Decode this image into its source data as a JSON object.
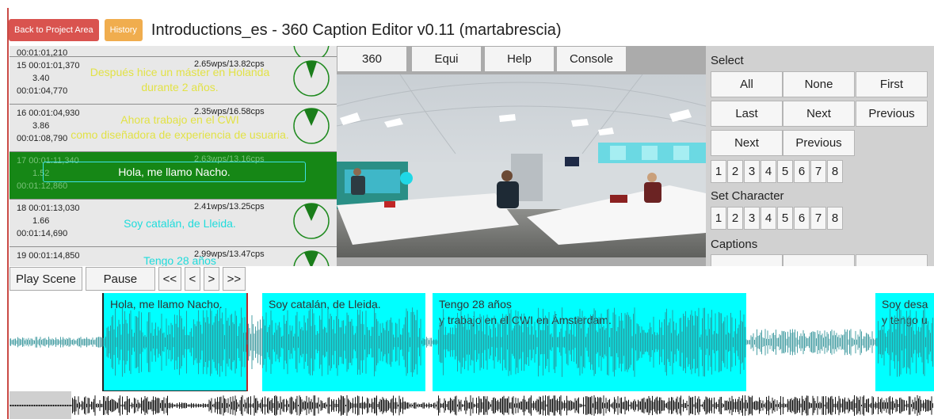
{
  "header": {
    "back_label": "Back to Project Area",
    "history_label": "History",
    "title": "Introductions_es - 360 Caption Editor v0.11 (martabrescia)"
  },
  "caption_list": {
    "partial_top": {
      "end": "00:01:01,210"
    },
    "rows": [
      {
        "index_start": "15 00:01:01,370",
        "duration": "3.40",
        "end": "00:01:04,770",
        "rate": "2.65wps/13.82cps",
        "lines": [
          "Después hice un máster en Holanda",
          "durante 2 años."
        ],
        "color": "yellow",
        "active": false,
        "gauge_fraction": 0.08
      },
      {
        "index_start": "16 00:01:04,930",
        "duration": "3.86",
        "end": "00:01:08,790",
        "rate": "2.35wps/16.58cps",
        "lines": [
          "Ahora trabajo en el CWI",
          "como diseñadora de experiencia de usuaria."
        ],
        "color": "yellow",
        "active": false,
        "gauge_fraction": 0.1
      },
      {
        "index_start": "17 00:01:11,340",
        "duration": "1.52",
        "end": "00:01:12,860",
        "rate": "2.63wps/13.16cps",
        "lines": [
          "Hola, me llamo Nacho."
        ],
        "color": "white",
        "active": true,
        "gauge_fraction": 0.1
      },
      {
        "index_start": "18 00:01:13,030",
        "duration": "1.66",
        "end": "00:01:14,690",
        "rate": "2.41wps/13.25cps",
        "lines": [
          "Soy catalán, de Lleida."
        ],
        "color": "cyan",
        "active": false,
        "gauge_fraction": 0.1
      },
      {
        "index_start": "19 00:01:14,850",
        "duration": "",
        "end": "",
        "rate": "2.99wps/13.47cps",
        "lines": [
          "Tengo 28 años"
        ],
        "color": "cyan",
        "active": false,
        "gauge_fraction": 0.1
      }
    ]
  },
  "video": {
    "tabs": [
      "360",
      "Equi",
      "Help",
      "Console"
    ]
  },
  "controls": {
    "select_heading": "Select",
    "select_buttons": [
      "All",
      "None",
      "First",
      "Last",
      "Next",
      "Previous",
      "Next",
      "Previous"
    ],
    "set_character_heading": "Set Character",
    "numbers": [
      "1",
      "2",
      "3",
      "4",
      "5",
      "6",
      "7",
      "8"
    ],
    "captions_heading": "Captions"
  },
  "playback": {
    "play_scene": "Play Scene",
    "pause": "Pause",
    "rewind_fast": "<<",
    "rewind": "<",
    "forward": ">",
    "forward_fast": ">>"
  },
  "timeline": {
    "segments": [
      {
        "text": "Hola, me llamo Nacho.",
        "selected": true
      },
      {
        "text": "Soy catalán, de Lleida.",
        "selected": false
      },
      {
        "text": "Tengo 28 años\ny trabajo en el CWI en Ámsterdam.",
        "selected": false
      },
      {
        "text": "Soy desa\ny tengo u",
        "selected": false
      }
    ]
  },
  "colors": {
    "back_button": "#d9534f",
    "history_button": "#f0ad4e",
    "active_row": "#168716",
    "segment": "#00ffff",
    "caption_yellow": "#e2e246",
    "caption_cyan": "#1fdcdc"
  }
}
